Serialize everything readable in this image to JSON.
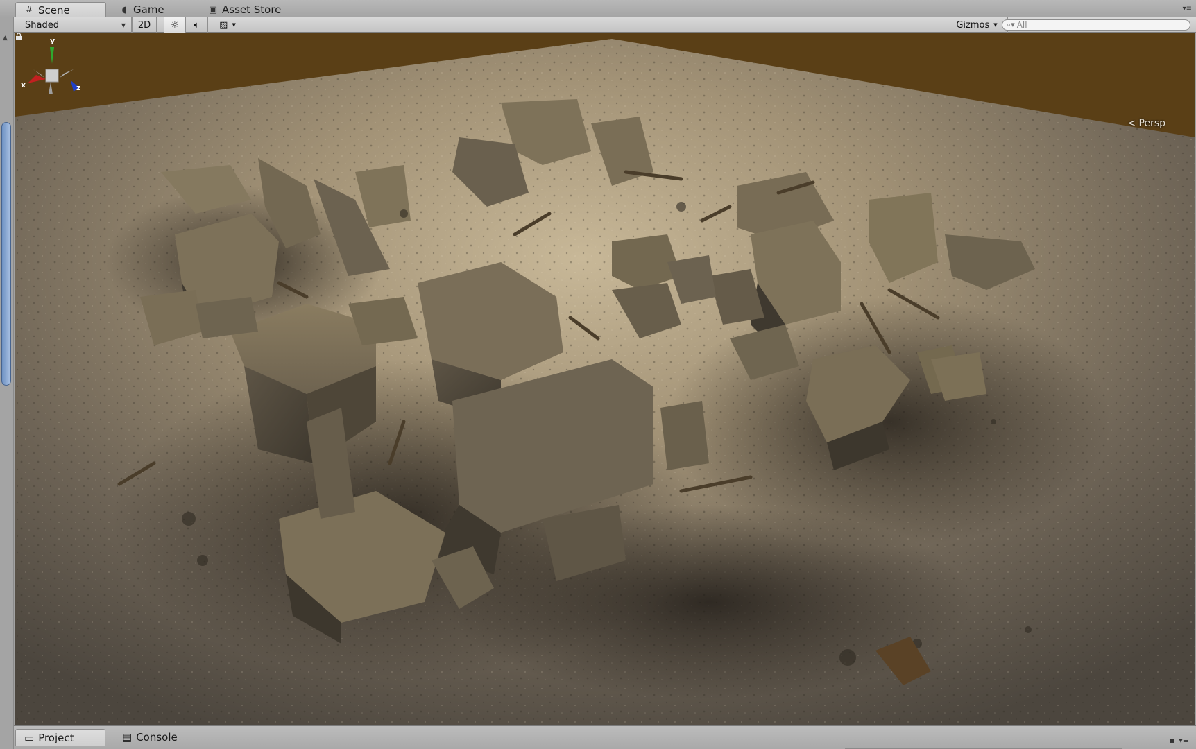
{
  "tabs": [
    {
      "label": "Scene",
      "icon": "grid-icon",
      "active": true
    },
    {
      "label": "Game",
      "icon": "pacman-icon",
      "active": false
    },
    {
      "label": "Asset Store",
      "icon": "bag-icon",
      "active": false
    }
  ],
  "toolbar": {
    "shading_mode": "Shaded",
    "mode_2d_label": "2D",
    "lighting_icon": "sun-icon",
    "audio_icon": "speaker-icon",
    "effects_icon": "image-icon",
    "gizmos_label": "Gizmos",
    "search_placeholder": "All"
  },
  "viewport": {
    "projection_label": "Persp",
    "axis_labels": {
      "x": "x",
      "y": "y",
      "z": "z"
    },
    "axis_colors": {
      "x": "#c22020",
      "y": "#2fa92f",
      "z": "#2040c8"
    },
    "sky_color": "#5a3f16"
  },
  "bottom_tabs": [
    {
      "label": "Project",
      "icon": "folder-icon",
      "active": true
    },
    {
      "label": "Console",
      "icon": "console-icon",
      "active": false
    }
  ]
}
